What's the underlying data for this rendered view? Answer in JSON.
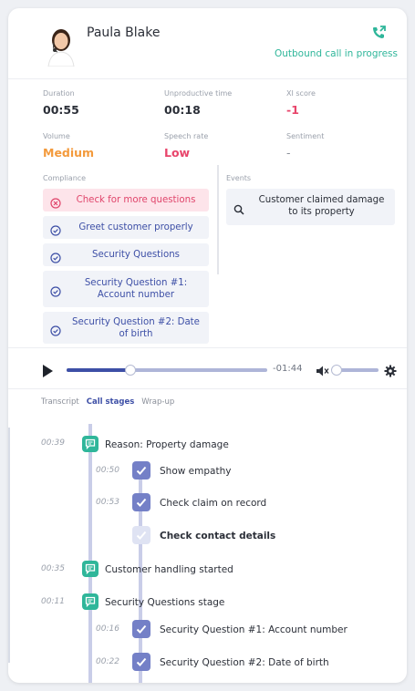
{
  "agent": {
    "name": "Paula Blake",
    "call_status": "Outbound call in progress"
  },
  "metrics": [
    {
      "label": "Duration",
      "value": "00:55"
    },
    {
      "label": "Unproductive time",
      "value": "00:18"
    },
    {
      "label": "XI score",
      "value": "-1"
    },
    {
      "label": "Volume",
      "value": "Medium"
    },
    {
      "label": "Speech rate",
      "value": "Low"
    },
    {
      "label": "Sentiment",
      "value": "-"
    }
  ],
  "compliance": {
    "label": "Compliance",
    "items": [
      {
        "text": "Check for more questions",
        "status": "fail"
      },
      {
        "text": "Greet customer properly",
        "status": "pass"
      },
      {
        "text": "Security Questions",
        "status": "pass"
      },
      {
        "text": "Security Question #1: Account number",
        "status": "pass"
      },
      {
        "text": "Security Question #2: Date of birth",
        "status": "pass"
      }
    ]
  },
  "events": {
    "label": "Events",
    "items": [
      {
        "text": "Customer claimed damage to its property"
      }
    ]
  },
  "player": {
    "remaining": "-01:44",
    "progress": 0.32,
    "volume": 0.0
  },
  "tabs": [
    {
      "label": "Transcript",
      "active": false
    },
    {
      "label": "Call stages",
      "active": true
    },
    {
      "label": "Wrap-up",
      "active": false
    }
  ],
  "timeline": {
    "stage1": {
      "time": "00:39",
      "label": "Reason: Property damage"
    },
    "step1": {
      "time": "00:50",
      "label": "Show empathy"
    },
    "step2": {
      "time": "00:53",
      "label": "Check claim on record"
    },
    "step3": {
      "time": "",
      "label": "Check contact details"
    },
    "stage2": {
      "time": "00:35",
      "label": "Customer handling started"
    },
    "stage3": {
      "time": "00:11",
      "label": "Security Questions stage"
    },
    "step4": {
      "time": "00:16",
      "label": "Security Question #1: Account number"
    },
    "step5": {
      "time": "00:22",
      "label": "Security Question #2: Date of birth"
    }
  },
  "colors": {
    "primary": "#3d4fa6",
    "accent_green": "#2fb69a",
    "negative": "#e8456b",
    "orange": "#f39a3c"
  }
}
